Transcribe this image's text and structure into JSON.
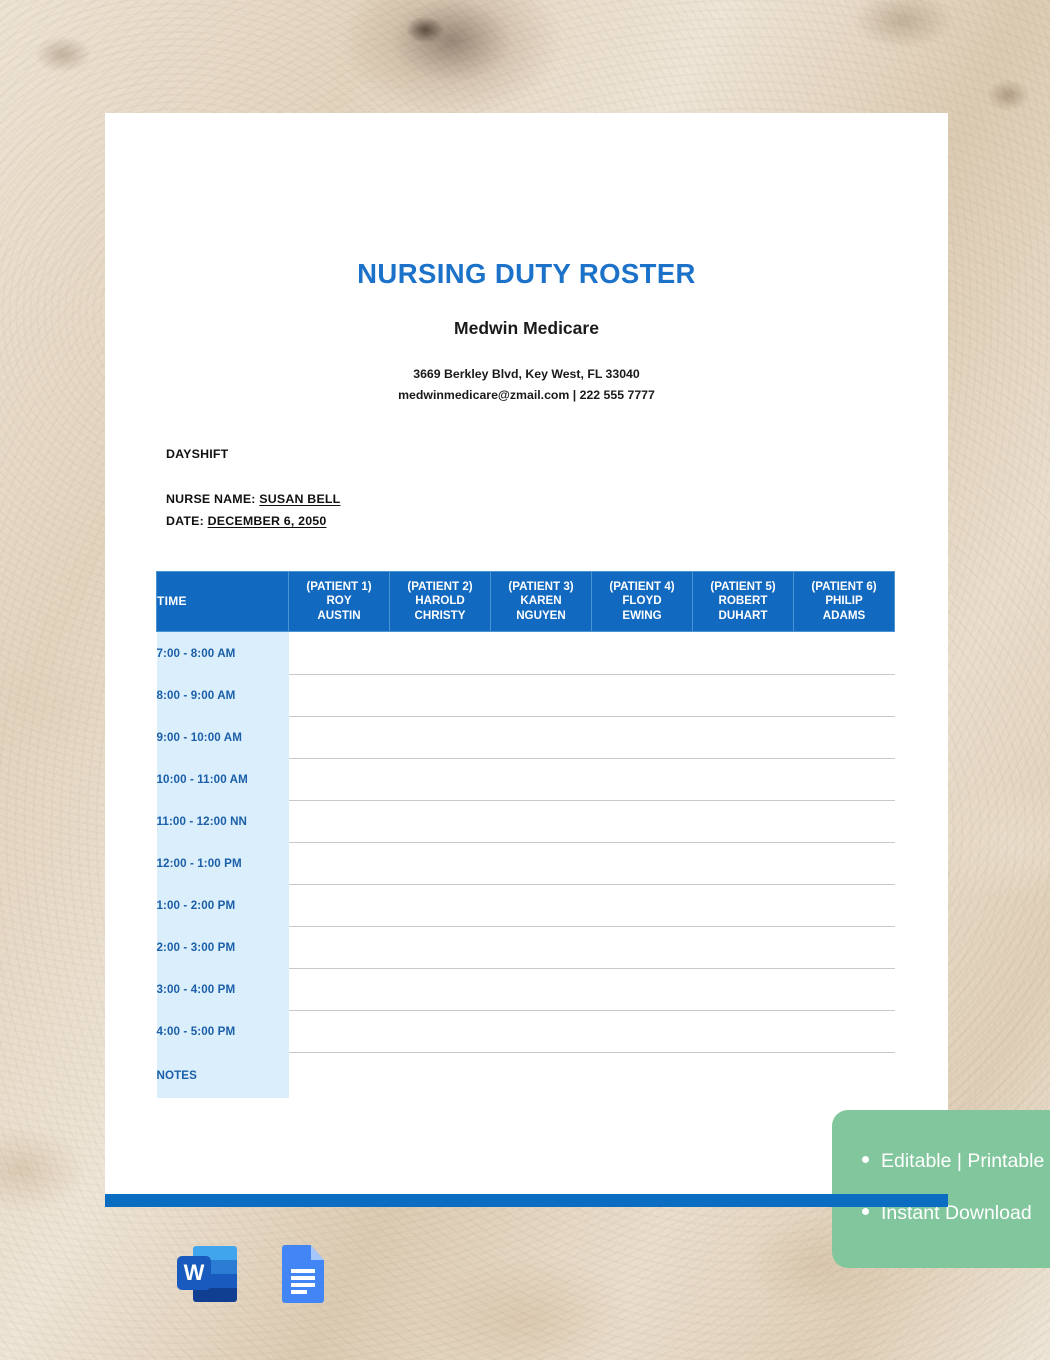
{
  "document": {
    "title": "NURSING DUTY ROSTER",
    "organization": "Medwin Medicare",
    "address_line": "3669 Berkley Blvd, Key West, FL 33040",
    "contact_line": "medwinmedicare@zmail.com | 222 555 7777",
    "shift_label": "DAYSHIFT",
    "nurse_label": "NURSE NAME:",
    "nurse_value": "SUSAN BELL",
    "date_label": "DATE:",
    "date_value": "DECEMBER 6, 2050"
  },
  "table": {
    "time_header": "TIME",
    "patients": [
      {
        "tag": "(PATIENT 1)",
        "first": "ROY",
        "last": "AUSTIN"
      },
      {
        "tag": "(PATIENT 2)",
        "first": "HAROLD",
        "last": "CHRISTY"
      },
      {
        "tag": "(PATIENT 3)",
        "first": "KAREN",
        "last": "NGUYEN"
      },
      {
        "tag": "(PATIENT 4)",
        "first": "FLOYD",
        "last": "EWING"
      },
      {
        "tag": "(PATIENT 5)",
        "first": "ROBERT",
        "last": "DUHART"
      },
      {
        "tag": "(PATIENT 6)",
        "first": "PHILIP",
        "last": "ADAMS"
      }
    ],
    "rows": [
      {
        "time": "7:00 - 8:00 AM",
        "entries": [
          "",
          "",
          "",
          "",
          "",
          ""
        ]
      },
      {
        "time": "8:00 - 9:00 AM",
        "entries": [
          "",
          "",
          "",
          "",
          "",
          ""
        ]
      },
      {
        "time": "9:00 - 10:00 AM",
        "entries": [
          "",
          "",
          "",
          "",
          "",
          ""
        ]
      },
      {
        "time": "10:00 - 11:00 AM",
        "entries": [
          "",
          "",
          "",
          "",
          "",
          ""
        ]
      },
      {
        "time": "11:00 - 12:00 NN",
        "entries": [
          "",
          "",
          "",
          "",
          "",
          ""
        ]
      },
      {
        "time": "12:00 - 1:00 PM",
        "entries": [
          "",
          "",
          "",
          "",
          "",
          ""
        ]
      },
      {
        "time": "1:00 - 2:00 PM",
        "entries": [
          "",
          "",
          "",
          "",
          "",
          ""
        ]
      },
      {
        "time": "2:00 - 3:00 PM",
        "entries": [
          "",
          "",
          "",
          "",
          "",
          ""
        ]
      },
      {
        "time": "3:00 - 4:00 PM",
        "entries": [
          "",
          "",
          "",
          "",
          "",
          ""
        ]
      },
      {
        "time": "4:00 - 5:00 PM",
        "entries": [
          "",
          "",
          "",
          "",
          "",
          ""
        ]
      },
      {
        "time": "NOTES",
        "entries": [
          "",
          "",
          "",
          "",
          "",
          ""
        ]
      }
    ]
  },
  "promo": {
    "lines": [
      "Editable | Printable",
      "Instant Download"
    ]
  },
  "formats": [
    {
      "name": "microsoft-word",
      "glyph": "W"
    },
    {
      "name": "google-docs",
      "glyph": ""
    }
  ],
  "colors": {
    "title_blue": "#1b72c8",
    "header_blue": "#1169c0",
    "time_cell_blue": "#dbeefc",
    "time_text_blue": "#1b5fa8",
    "bottom_bar_blue": "#0a6dc2",
    "promo_green": "#81c69c",
    "row_rule_gray": "#c9c9c9"
  }
}
